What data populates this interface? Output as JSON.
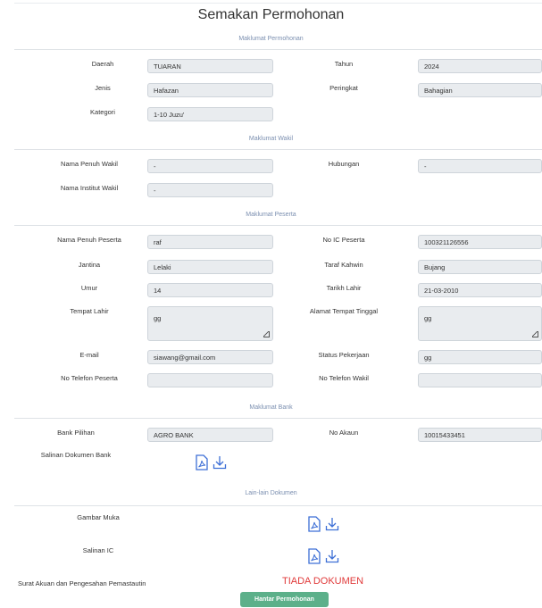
{
  "title": "Semakan Permohonan",
  "sections": {
    "permohonan": "Maklumat Permohonan",
    "wakil": "Maklumat Wakil",
    "peserta": "Maklumat Peserta",
    "bank": "Maklumat Bank",
    "dokumen": "Lain-lain Dokumen"
  },
  "permohonan": {
    "daerah_label": "Daerah",
    "daerah": "TUARAN",
    "tahun_label": "Tahun",
    "tahun": "2024",
    "jenis_label": "Jenis",
    "jenis": "Hafazan",
    "peringkat_label": "Peringkat",
    "peringkat": "Bahagian",
    "kategori_label": "Kategori",
    "kategori": "1-10 Juzu'"
  },
  "wakil": {
    "nama_label": "Nama Penuh Wakil",
    "nama": "-",
    "hubungan_label": "Hubungan",
    "hubungan": "-",
    "institut_label": "Nama Institut Wakil",
    "institut": "-"
  },
  "peserta": {
    "nama_label": "Nama Penuh Peserta",
    "nama": "raf",
    "ic_label": "No IC Peserta",
    "ic": "100321126556",
    "jantina_label": "Jantina",
    "jantina": "Lelaki",
    "taraf_label": "Taraf Kahwin",
    "taraf": "Bujang",
    "umur_label": "Umur",
    "umur": "14",
    "tarikh_label": "Tarikh Lahir",
    "tarikh": "21-03-2010",
    "tempat_label": "Tempat Lahir",
    "tempat": "gg",
    "alamat_label": "Alamat Tempat Tinggal",
    "alamat": "gg",
    "email_label": "E-mail",
    "email": "siawang@gmail.com",
    "status_label": "Status Pekerjaan",
    "status": "gg",
    "telefon_label": "No Telefon Peserta",
    "telefon": "",
    "telefon_wakil_label": "No Telefon Wakil",
    "telefon_wakil": ""
  },
  "bank": {
    "pilihan_label": "Bank Pilihan",
    "pilihan": "AGRO BANK",
    "akaun_label": "No Akaun",
    "akaun": "10015433451",
    "salinan_label": "Salinan Dokumen Bank"
  },
  "dokumen": {
    "gambar_label": "Gambar Muka",
    "ic_label": "Salinan IC",
    "surat_label": "Surat Akuan dan Pengesahan Pemastautin",
    "tiada": "TIADA DOKUMEN"
  },
  "submit_label": "Hantar Permohonan",
  "colors": {
    "accent": "#5cb08a",
    "error": "#e03a3a",
    "icon": "#3d6fd6",
    "section": "#7b8fb0"
  },
  "icons": {
    "pdf": "pdf-file-icon",
    "download": "download-icon"
  }
}
